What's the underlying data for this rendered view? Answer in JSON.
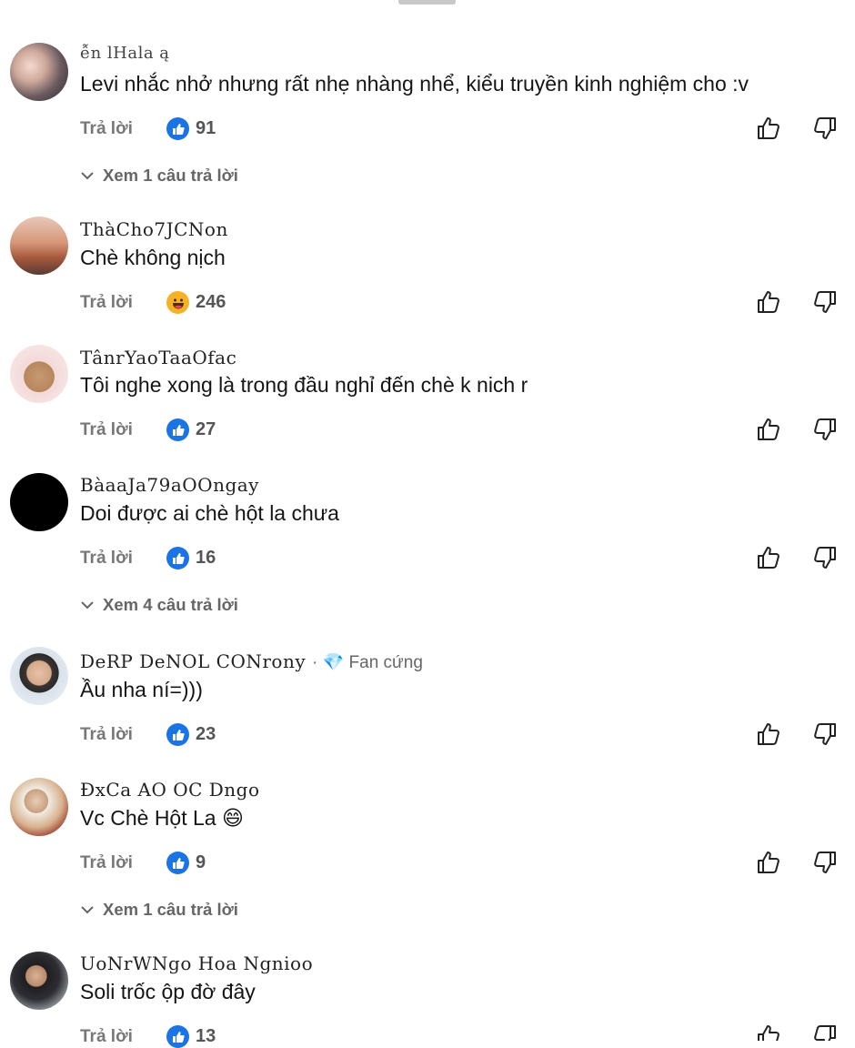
{
  "comments": [
    {
      "author": "ễn lHala ą",
      "text": "Levi nhắc nhở nhưng rất nhẹ nhàng nhể, kiểu truyền kinh nghiệm cho :v",
      "reply_label": "Trả lời",
      "reaction": "like",
      "count": "91",
      "view_replies": "Xem 1 câu trả lời"
    },
    {
      "author": "ThàCho7JCNon",
      "text": "Chè không nịch",
      "reply_label": "Trả lời",
      "reaction": "haha",
      "count": "246"
    },
    {
      "author": "TânrYaoTaaOfac",
      "text": "Tôi nghe xong là trong đầu nghỉ đến chè k nich r",
      "reply_label": "Trả lời",
      "reaction": "like",
      "count": "27"
    },
    {
      "author": "BàaaJa79aOOngay",
      "text": "Doi được ai chè hột la chưa",
      "reply_label": "Trả lời",
      "reaction": "like",
      "count": "16",
      "view_replies": "Xem 4 câu trả lời"
    },
    {
      "author": "DeRP DeNOL CONrony",
      "badge": "· 💎 Fan cứng",
      "text": "Ầu nha ní=)))",
      "reply_label": "Trả lời",
      "reaction": "like",
      "count": "23"
    },
    {
      "author": "ĐxCa AO OC Dngo",
      "text": "Vc Chè Hột La 😄",
      "reply_label": "Trả lời",
      "reaction": "like",
      "count": "9",
      "view_replies": "Xem 1 câu trả lời"
    },
    {
      "author": "UoNrWNgo Hoa Ngnioo",
      "text": "Soli trốc ộp đờ đây",
      "reply_label": "Trả lời",
      "reaction": "like",
      "count": "13"
    }
  ],
  "colors": {
    "like_blue": "#1b74e4",
    "haha_yellow": "#f7b125",
    "text_gray": "#777777"
  }
}
